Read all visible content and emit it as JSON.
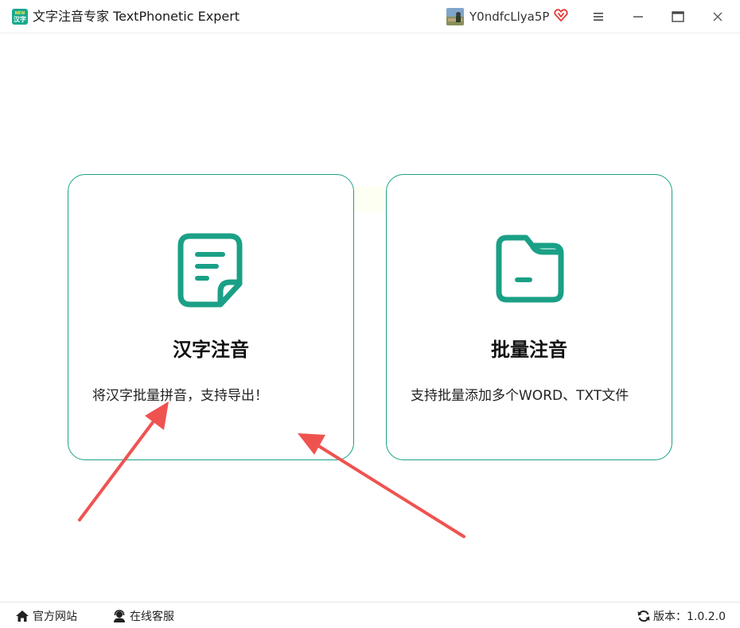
{
  "app": {
    "title": "文字注音专家 TextPhonetic Expert",
    "logo_top": "NEW",
    "logo_bottom": "汉字"
  },
  "user": {
    "name": "Y0ndfcLlya5P",
    "vip_icon": "heart-vip-icon"
  },
  "window_controls": [
    "menu-icon",
    "minimize-icon",
    "maximize-icon",
    "close-icon"
  ],
  "cards": [
    {
      "title": "汉字注音",
      "desc": "将汉字批量拼音，支持导出！",
      "icon": "document-icon"
    },
    {
      "title": "批量注音",
      "desc": "支持批量添加多个WORD、TXT文件",
      "icon": "folder-icon"
    }
  ],
  "footer": {
    "site_label": "官方网站",
    "service_label": "在线客服",
    "version_label": "版本：1.0.2.0"
  },
  "colors": {
    "accent": "#1aa086",
    "arrow": "#ef5350",
    "vip": "#e53935"
  }
}
